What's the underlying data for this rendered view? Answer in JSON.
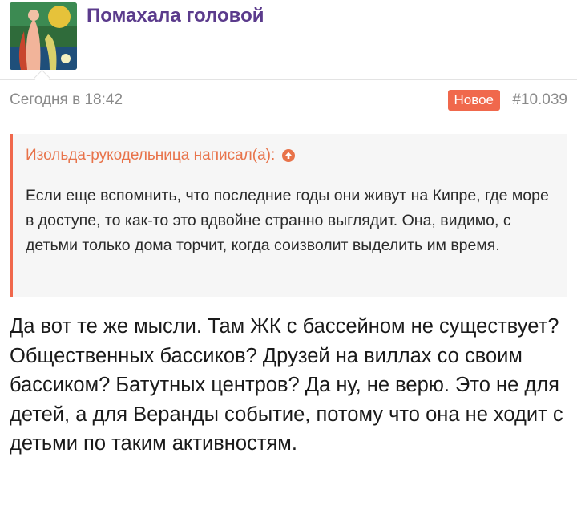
{
  "post": {
    "username": "Помахала головой",
    "timestamp": "Сегодня в 18:42",
    "badge": "Новое",
    "post_number": "#10.039"
  },
  "quote": {
    "author": "Изольда-рукодельница написал(а):",
    "text": "Если еще вспомнить, что последние годы они живут на Кипре, где море в доступе, то как-то это вдвойне странно выглядит. Она, видимо, с детьми только дома торчит, когда соизволит выделить им время."
  },
  "message": {
    "text": "Да вот те же мысли. Там ЖК с бассейном не существует? Общественных бассиков? Друзей на виллах со своим бассиком? Батутных центров? Да ну, не верю. Это не для детей, а для Веранды событие, потому что она не ходит с детьми по таким активностям."
  },
  "icons": {
    "avatar": "painting-avatar",
    "quote_link": "arrow-up-circle-icon"
  },
  "colors": {
    "username": "#5b3b8c",
    "accent": "#f0684c",
    "quote_author": "#e8734a"
  }
}
